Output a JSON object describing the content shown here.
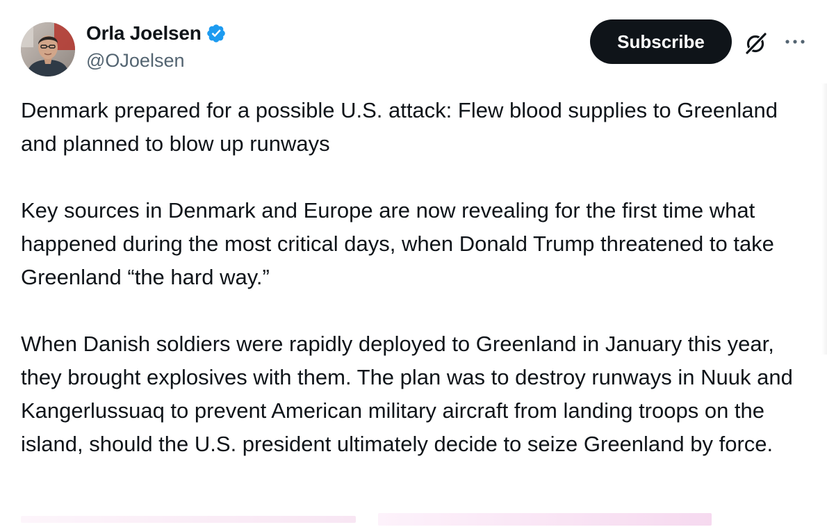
{
  "author": {
    "display_name": "Orla Joelsen",
    "handle": "@OJoelsen",
    "verified": true,
    "avatar_icon": "profile-photo"
  },
  "actions": {
    "subscribe_label": "Subscribe",
    "grok_icon": "grok-icon",
    "more_icon": "more-options-icon"
  },
  "post": {
    "paragraphs": [
      "Denmark prepared for a possible U.S. attack: Flew blood supplies to Greenland and planned to blow up runways",
      "Key sources in Denmark and Europe are now revealing for the first time what happened during the most critical days, when Donald Trump threatened to take Greenland “the hard way.”",
      "When Danish soldiers were rapidly deployed to Greenland in January this year, they brought explosives with them. The plan was to destroy runways in Nuuk and Kangerlussuaq to prevent American military aircraft from landing troops on the island, should the U.S. president ultimately decide to seize Greenland by force."
    ]
  },
  "colors": {
    "text_primary": "#0f1419",
    "text_secondary": "#536471",
    "verified_blue": "#1d9bf0",
    "button_dark": "#0f1419"
  }
}
